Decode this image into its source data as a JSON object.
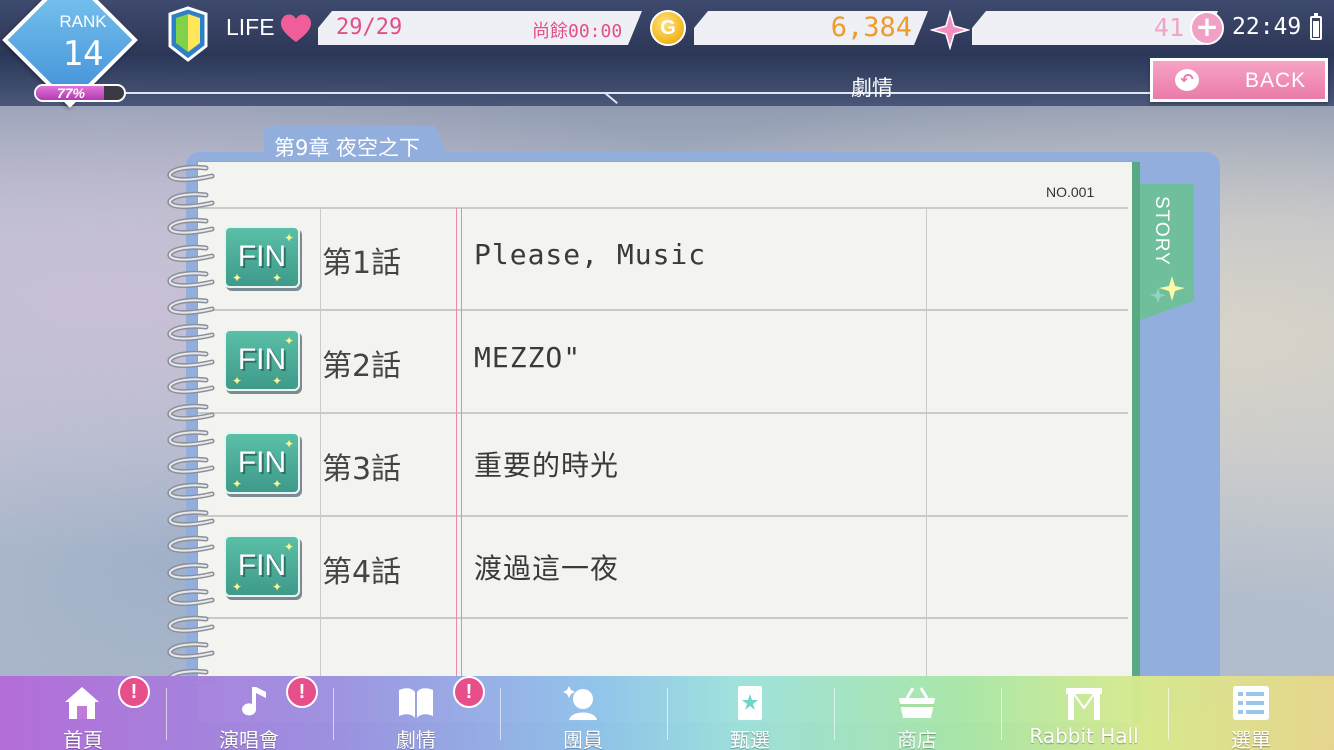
{
  "status": {
    "rank_label": "RANK",
    "rank_value": "14",
    "rank_progress_text": "77%",
    "rank_progress": 0.77,
    "life_label": "LIFE",
    "life_value": "29/29",
    "life_remaining": "尚餘00:00",
    "coin_symbol": "G",
    "gold": "6,384",
    "gems": "41",
    "plus": "+",
    "clock": "22:49",
    "battery_level": 0.9
  },
  "header": {
    "title": "劇情",
    "back_label": "BACK",
    "back_arrow": "↶"
  },
  "notebook": {
    "chapter": "第9章  夜空之下",
    "page_number": "NO.001",
    "side_tab": "STORY",
    "episodes": [
      {
        "badge": "FIN",
        "label": "第1話",
        "title": "Please, Music"
      },
      {
        "badge": "FIN",
        "label": "第2話",
        "title": "MEZZO\""
      },
      {
        "badge": "FIN",
        "label": "第3話",
        "title": "重要的時光"
      },
      {
        "badge": "FIN",
        "label": "第4話",
        "title": "渡過這一夜"
      }
    ]
  },
  "bottom_nav": {
    "items": [
      {
        "label": "首頁",
        "icon": "home-icon",
        "alert": "!"
      },
      {
        "label": "演唱會",
        "icon": "music-note-icon",
        "alert": "!"
      },
      {
        "label": "劇情",
        "icon": "book-icon",
        "alert": "!"
      },
      {
        "label": "團員",
        "icon": "member-icon"
      },
      {
        "label": "甄選",
        "icon": "card-icon"
      },
      {
        "label": "商店",
        "icon": "basket-icon"
      },
      {
        "label": "Rabbit Hall",
        "icon": "stage-icon"
      },
      {
        "label": "選單",
        "icon": "menu-list-icon"
      }
    ]
  },
  "colors": {
    "accent_pink": "#ea7ba9",
    "fin_green": "#4fae98",
    "notebook_blue": "#92aedd",
    "gold_text": "#f09a2a"
  }
}
